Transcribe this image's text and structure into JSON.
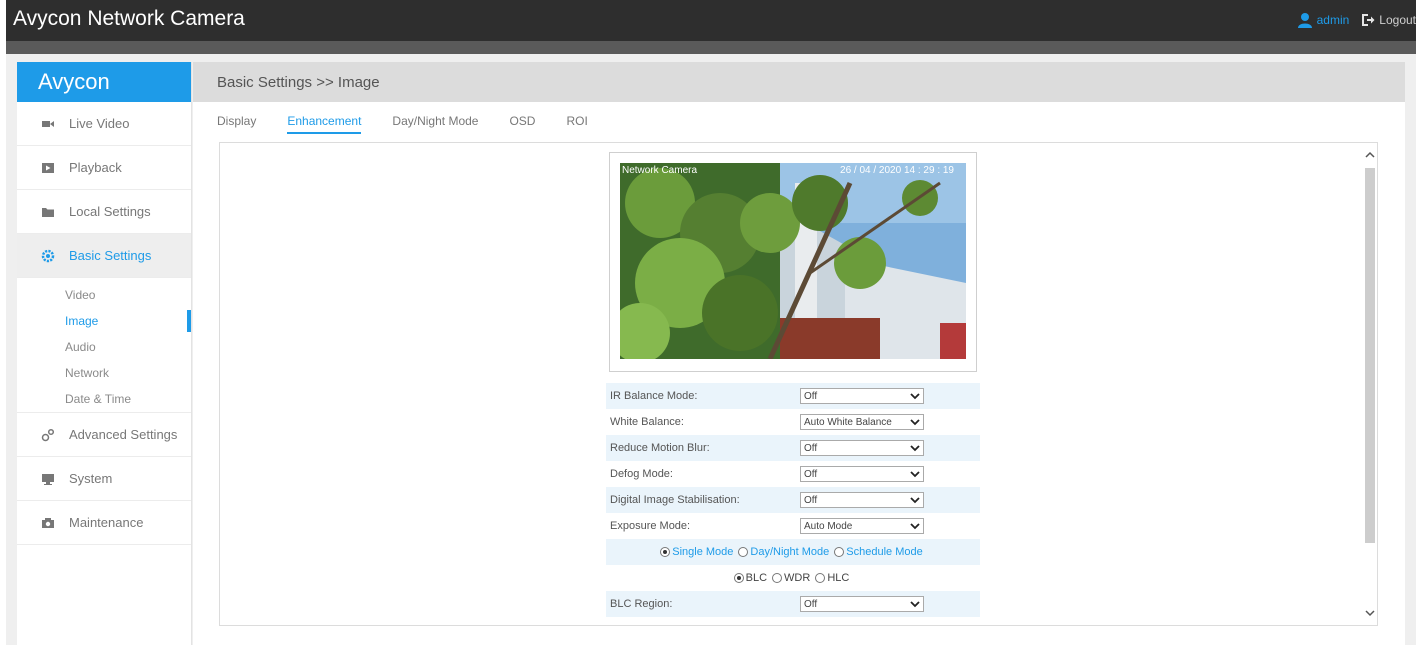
{
  "header": {
    "title": "Avycon Network Camera",
    "user": "admin",
    "logout": "Logout"
  },
  "sidebar": {
    "brand": "Avycon",
    "items": [
      {
        "label": "Live Video",
        "icon": "video-icon"
      },
      {
        "label": "Playback",
        "icon": "playback-icon"
      },
      {
        "label": "Local Settings",
        "icon": "folder-icon"
      },
      {
        "label": "Basic Settings",
        "icon": "gear-icon"
      },
      {
        "label": "Advanced Settings",
        "icon": "advanced-gears-icon"
      },
      {
        "label": "System",
        "icon": "monitor-icon"
      },
      {
        "label": "Maintenance",
        "icon": "camera-icon"
      }
    ],
    "sub_items": [
      "Video",
      "Image",
      "Audio",
      "Network",
      "Date & Time"
    ],
    "active_item": "Basic Settings",
    "active_sub": "Image"
  },
  "main": {
    "breadcrumb": "Basic Settings >> Image",
    "tabs": [
      "Display",
      "Enhancement",
      "Day/Night Mode",
      "OSD",
      "ROI"
    ],
    "active_tab": "Enhancement"
  },
  "preview": {
    "osd_name": "Network Camera",
    "osd_time": "26 / 04 / 2020   14 : 29 : 19"
  },
  "settings": {
    "rows": [
      {
        "label": "IR Balance Mode:",
        "value": "Off"
      },
      {
        "label": "White Balance:",
        "value": "Auto White Balance"
      },
      {
        "label": "Reduce Motion Blur:",
        "value": "Off"
      },
      {
        "label": "Defog Mode:",
        "value": "Off"
      },
      {
        "label": "Digital Image Stabilisation:",
        "value": "Off"
      },
      {
        "label": "Exposure Mode:",
        "value": "Auto Mode"
      }
    ],
    "mode_radios": [
      "Single Mode",
      "Day/Night Mode",
      "Schedule Mode"
    ],
    "mode_selected": "Single Mode",
    "comp_radios": [
      "BLC",
      "WDR",
      "HLC"
    ],
    "comp_selected": "BLC",
    "blc_region": {
      "label": "BLC Region:",
      "value": "Off"
    }
  },
  "colors": {
    "accent": "#1e9be8",
    "topbar": "#2e2e2e",
    "row_shade": "#eaf4fb"
  }
}
